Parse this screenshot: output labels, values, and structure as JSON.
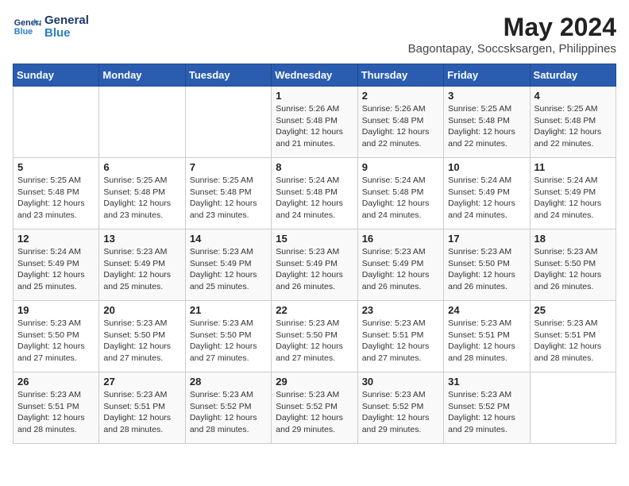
{
  "logo": {
    "text_general": "General",
    "text_blue": "Blue"
  },
  "header": {
    "title": "May 2024",
    "subtitle": "Bagontapay, Soccsksargen, Philippines"
  },
  "weekdays": [
    "Sunday",
    "Monday",
    "Tuesday",
    "Wednesday",
    "Thursday",
    "Friday",
    "Saturday"
  ],
  "weeks": [
    [
      {
        "day": "",
        "info": ""
      },
      {
        "day": "",
        "info": ""
      },
      {
        "day": "",
        "info": ""
      },
      {
        "day": "1",
        "info": "Sunrise: 5:26 AM\nSunset: 5:48 PM\nDaylight: 12 hours\nand 21 minutes."
      },
      {
        "day": "2",
        "info": "Sunrise: 5:26 AM\nSunset: 5:48 PM\nDaylight: 12 hours\nand 22 minutes."
      },
      {
        "day": "3",
        "info": "Sunrise: 5:25 AM\nSunset: 5:48 PM\nDaylight: 12 hours\nand 22 minutes."
      },
      {
        "day": "4",
        "info": "Sunrise: 5:25 AM\nSunset: 5:48 PM\nDaylight: 12 hours\nand 22 minutes."
      }
    ],
    [
      {
        "day": "5",
        "info": "Sunrise: 5:25 AM\nSunset: 5:48 PM\nDaylight: 12 hours\nand 23 minutes."
      },
      {
        "day": "6",
        "info": "Sunrise: 5:25 AM\nSunset: 5:48 PM\nDaylight: 12 hours\nand 23 minutes."
      },
      {
        "day": "7",
        "info": "Sunrise: 5:25 AM\nSunset: 5:48 PM\nDaylight: 12 hours\nand 23 minutes."
      },
      {
        "day": "8",
        "info": "Sunrise: 5:24 AM\nSunset: 5:48 PM\nDaylight: 12 hours\nand 24 minutes."
      },
      {
        "day": "9",
        "info": "Sunrise: 5:24 AM\nSunset: 5:48 PM\nDaylight: 12 hours\nand 24 minutes."
      },
      {
        "day": "10",
        "info": "Sunrise: 5:24 AM\nSunset: 5:49 PM\nDaylight: 12 hours\nand 24 minutes."
      },
      {
        "day": "11",
        "info": "Sunrise: 5:24 AM\nSunset: 5:49 PM\nDaylight: 12 hours\nand 24 minutes."
      }
    ],
    [
      {
        "day": "12",
        "info": "Sunrise: 5:24 AM\nSunset: 5:49 PM\nDaylight: 12 hours\nand 25 minutes."
      },
      {
        "day": "13",
        "info": "Sunrise: 5:23 AM\nSunset: 5:49 PM\nDaylight: 12 hours\nand 25 minutes."
      },
      {
        "day": "14",
        "info": "Sunrise: 5:23 AM\nSunset: 5:49 PM\nDaylight: 12 hours\nand 25 minutes."
      },
      {
        "day": "15",
        "info": "Sunrise: 5:23 AM\nSunset: 5:49 PM\nDaylight: 12 hours\nand 26 minutes."
      },
      {
        "day": "16",
        "info": "Sunrise: 5:23 AM\nSunset: 5:49 PM\nDaylight: 12 hours\nand 26 minutes."
      },
      {
        "day": "17",
        "info": "Sunrise: 5:23 AM\nSunset: 5:50 PM\nDaylight: 12 hours\nand 26 minutes."
      },
      {
        "day": "18",
        "info": "Sunrise: 5:23 AM\nSunset: 5:50 PM\nDaylight: 12 hours\nand 26 minutes."
      }
    ],
    [
      {
        "day": "19",
        "info": "Sunrise: 5:23 AM\nSunset: 5:50 PM\nDaylight: 12 hours\nand 27 minutes."
      },
      {
        "day": "20",
        "info": "Sunrise: 5:23 AM\nSunset: 5:50 PM\nDaylight: 12 hours\nand 27 minutes."
      },
      {
        "day": "21",
        "info": "Sunrise: 5:23 AM\nSunset: 5:50 PM\nDaylight: 12 hours\nand 27 minutes."
      },
      {
        "day": "22",
        "info": "Sunrise: 5:23 AM\nSunset: 5:50 PM\nDaylight: 12 hours\nand 27 minutes."
      },
      {
        "day": "23",
        "info": "Sunrise: 5:23 AM\nSunset: 5:51 PM\nDaylight: 12 hours\nand 27 minutes."
      },
      {
        "day": "24",
        "info": "Sunrise: 5:23 AM\nSunset: 5:51 PM\nDaylight: 12 hours\nand 28 minutes."
      },
      {
        "day": "25",
        "info": "Sunrise: 5:23 AM\nSunset: 5:51 PM\nDaylight: 12 hours\nand 28 minutes."
      }
    ],
    [
      {
        "day": "26",
        "info": "Sunrise: 5:23 AM\nSunset: 5:51 PM\nDaylight: 12 hours\nand 28 minutes."
      },
      {
        "day": "27",
        "info": "Sunrise: 5:23 AM\nSunset: 5:51 PM\nDaylight: 12 hours\nand 28 minutes."
      },
      {
        "day": "28",
        "info": "Sunrise: 5:23 AM\nSunset: 5:52 PM\nDaylight: 12 hours\nand 28 minutes."
      },
      {
        "day": "29",
        "info": "Sunrise: 5:23 AM\nSunset: 5:52 PM\nDaylight: 12 hours\nand 29 minutes."
      },
      {
        "day": "30",
        "info": "Sunrise: 5:23 AM\nSunset: 5:52 PM\nDaylight: 12 hours\nand 29 minutes."
      },
      {
        "day": "31",
        "info": "Sunrise: 5:23 AM\nSunset: 5:52 PM\nDaylight: 12 hours\nand 29 minutes."
      },
      {
        "day": "",
        "info": ""
      }
    ]
  ]
}
